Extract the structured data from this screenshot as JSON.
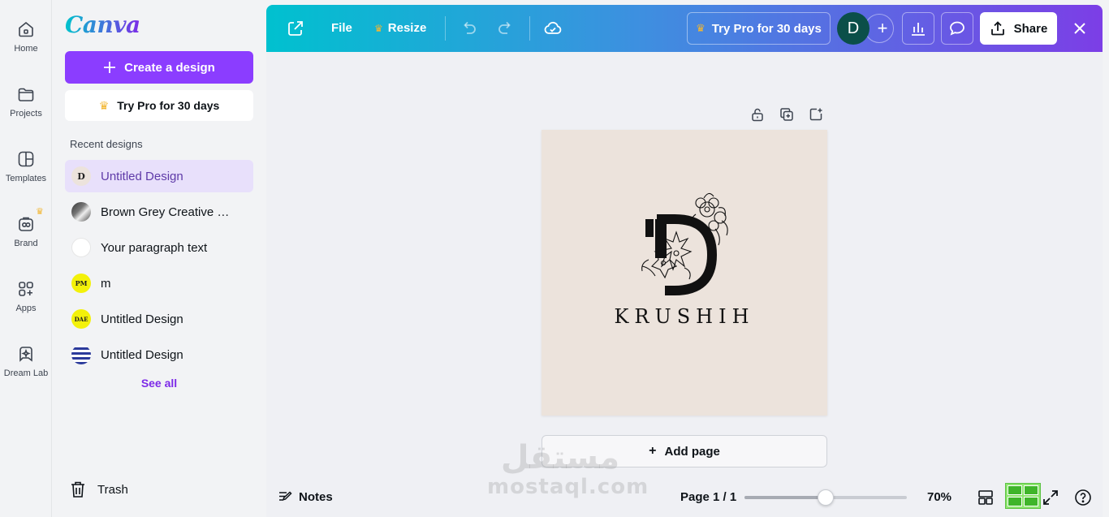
{
  "rail": {
    "items": [
      {
        "label": "Home",
        "icon": "home-icon"
      },
      {
        "label": "Projects",
        "icon": "folder-icon"
      },
      {
        "label": "Templates",
        "icon": "templates-icon"
      },
      {
        "label": "Brand",
        "icon": "brand-icon"
      },
      {
        "label": "Apps",
        "icon": "apps-icon"
      },
      {
        "label": "Dream Lab",
        "icon": "dream-lab-icon"
      }
    ]
  },
  "sidebar": {
    "logo": "Canva",
    "create_label": "Create a design",
    "pro_label": "Try Pro for 30 days",
    "recent_title": "Recent designs",
    "recent": [
      {
        "label": "Untitled Design",
        "thumb": "D",
        "active": true
      },
      {
        "label": "Brown Grey Creative M…",
        "thumb": ""
      },
      {
        "label": "Your paragraph text",
        "thumb": ""
      },
      {
        "label": "m",
        "thumb": "PM"
      },
      {
        "label": "Untitled Design",
        "thumb": "DAE"
      },
      {
        "label": "Untitled Design",
        "thumb": ""
      }
    ],
    "see_all": "See all",
    "trash": "Trash"
  },
  "topbar": {
    "file": "File",
    "resize": "Resize",
    "pro_label": "Try Pro for 30 days",
    "avatar_initial": "D",
    "share": "Share"
  },
  "canvas": {
    "brand_text": "KRUSHIH",
    "background": "#ece3dc",
    "add_page": "Add page"
  },
  "watermark": {
    "arabic": "مستقل",
    "latin": "mostaql.com"
  },
  "bottombar": {
    "notes": "Notes",
    "page_indicator": "Page 1 / 1",
    "zoom_level": "70%",
    "zoom_fraction": 0.5
  },
  "colors": {
    "accent": "#8b3dff",
    "link": "#7d2ae8",
    "gradient_start": "#00c1cf",
    "gradient_end": "#7c3ee6"
  }
}
